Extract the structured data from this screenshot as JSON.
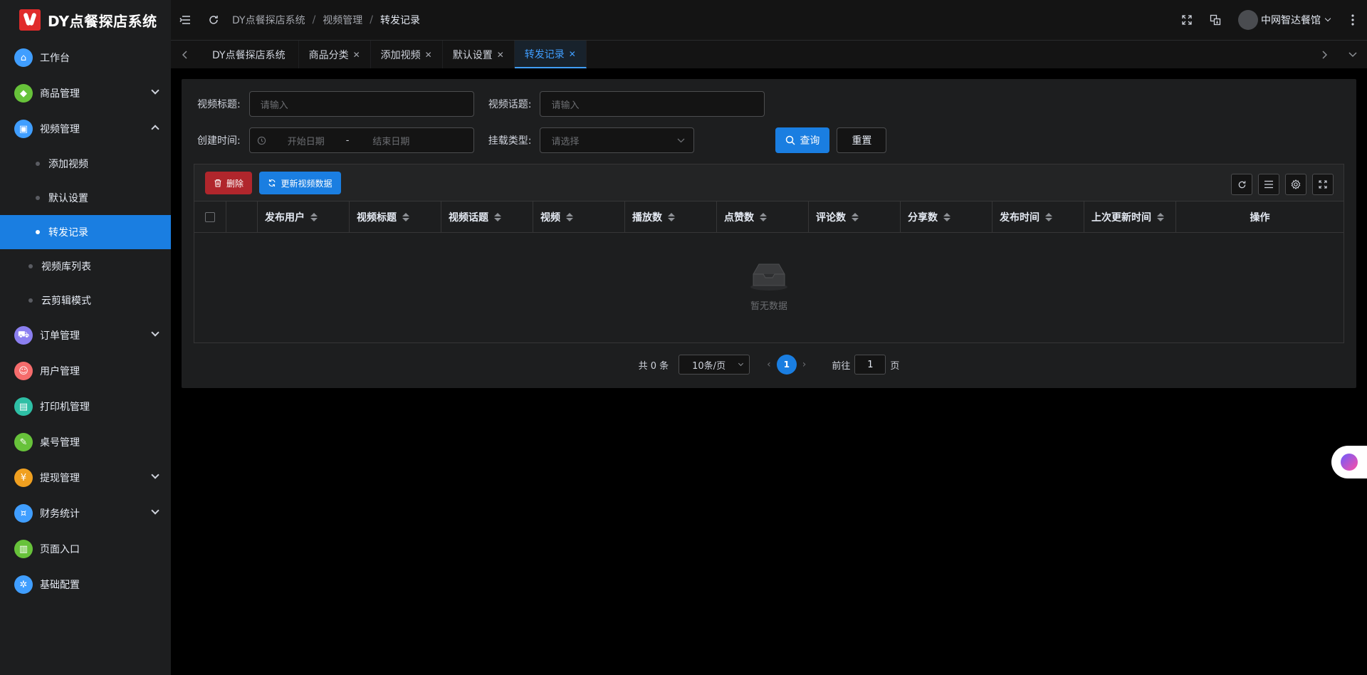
{
  "app": {
    "title": "DY点餐探店系统"
  },
  "sidebar": {
    "items": [
      {
        "label": "工作台",
        "icon": "home-icon",
        "color": "#409eff",
        "glyph": "⌂"
      },
      {
        "label": "商品管理",
        "icon": "bag-icon",
        "color": "#67c23a",
        "glyph": "◆"
      },
      {
        "label": "视频管理",
        "icon": "cube-icon",
        "color": "#409eff",
        "glyph": "▣"
      },
      {
        "label": "订单管理",
        "icon": "cart-icon",
        "color": "#8b7ff0",
        "glyph": "⛟"
      },
      {
        "label": "用户管理",
        "icon": "users-icon",
        "color": "#f56c6c",
        "glyph": "☺"
      },
      {
        "label": "打印机管理",
        "icon": "document-icon",
        "color": "#2ebfa5",
        "glyph": "▤"
      },
      {
        "label": "桌号管理",
        "icon": "pen-icon",
        "color": "#67c23a",
        "glyph": "✎"
      },
      {
        "label": "提现管理",
        "icon": "yen-icon",
        "color": "#f0a020",
        "glyph": "¥"
      },
      {
        "label": "财务统计",
        "icon": "coin-icon",
        "color": "#409eff",
        "glyph": "¤"
      },
      {
        "label": "页面入口",
        "icon": "page-icon",
        "color": "#67c23a",
        "glyph": "▥"
      },
      {
        "label": "基础配置",
        "icon": "config-icon",
        "color": "#409eff",
        "glyph": "✲"
      }
    ],
    "video_sub": [
      "添加视频",
      "默认设置",
      "转发记录"
    ],
    "video_sub2": [
      "视频库列表",
      "云剪辑模式"
    ]
  },
  "header": {
    "breadcrumb": [
      "DY点餐探店系统",
      "视频管理",
      "转发记录"
    ],
    "user_name": "中网智达餐馆"
  },
  "tabs": [
    {
      "label": "DY点餐探店系统",
      "closable": false
    },
    {
      "label": "商品分类",
      "closable": true
    },
    {
      "label": "添加视频",
      "closable": true
    },
    {
      "label": "默认设置",
      "closable": true
    },
    {
      "label": "转发记录",
      "closable": true
    }
  ],
  "filters": {
    "video_title_label": "视频标题:",
    "video_title_placeholder": "请输入",
    "video_topic_label": "视频话题:",
    "video_topic_placeholder": "请输入",
    "created_label": "创建时间:",
    "start_placeholder": "开始日期",
    "range_sep": "-",
    "end_placeholder": "结束日期",
    "mount_type_label": "挂载类型:",
    "mount_type_placeholder": "请选择",
    "search_label": "查询",
    "reset_label": "重置"
  },
  "toolbar": {
    "delete_label": "删除",
    "update_label": "更新视频数据"
  },
  "table": {
    "columns": [
      "发布用户",
      "视频标题",
      "视频话题",
      "视频",
      "播放数",
      "点赞数",
      "评论数",
      "分享数",
      "发布时间",
      "上次更新时间"
    ],
    "action_header": "操作",
    "empty_text": "暂无数据"
  },
  "pager": {
    "total_text": "共 0 条",
    "page_size": "10条/页",
    "current_page": "1",
    "goto_label": "前往",
    "goto_value": "1",
    "page_suffix": "页"
  }
}
